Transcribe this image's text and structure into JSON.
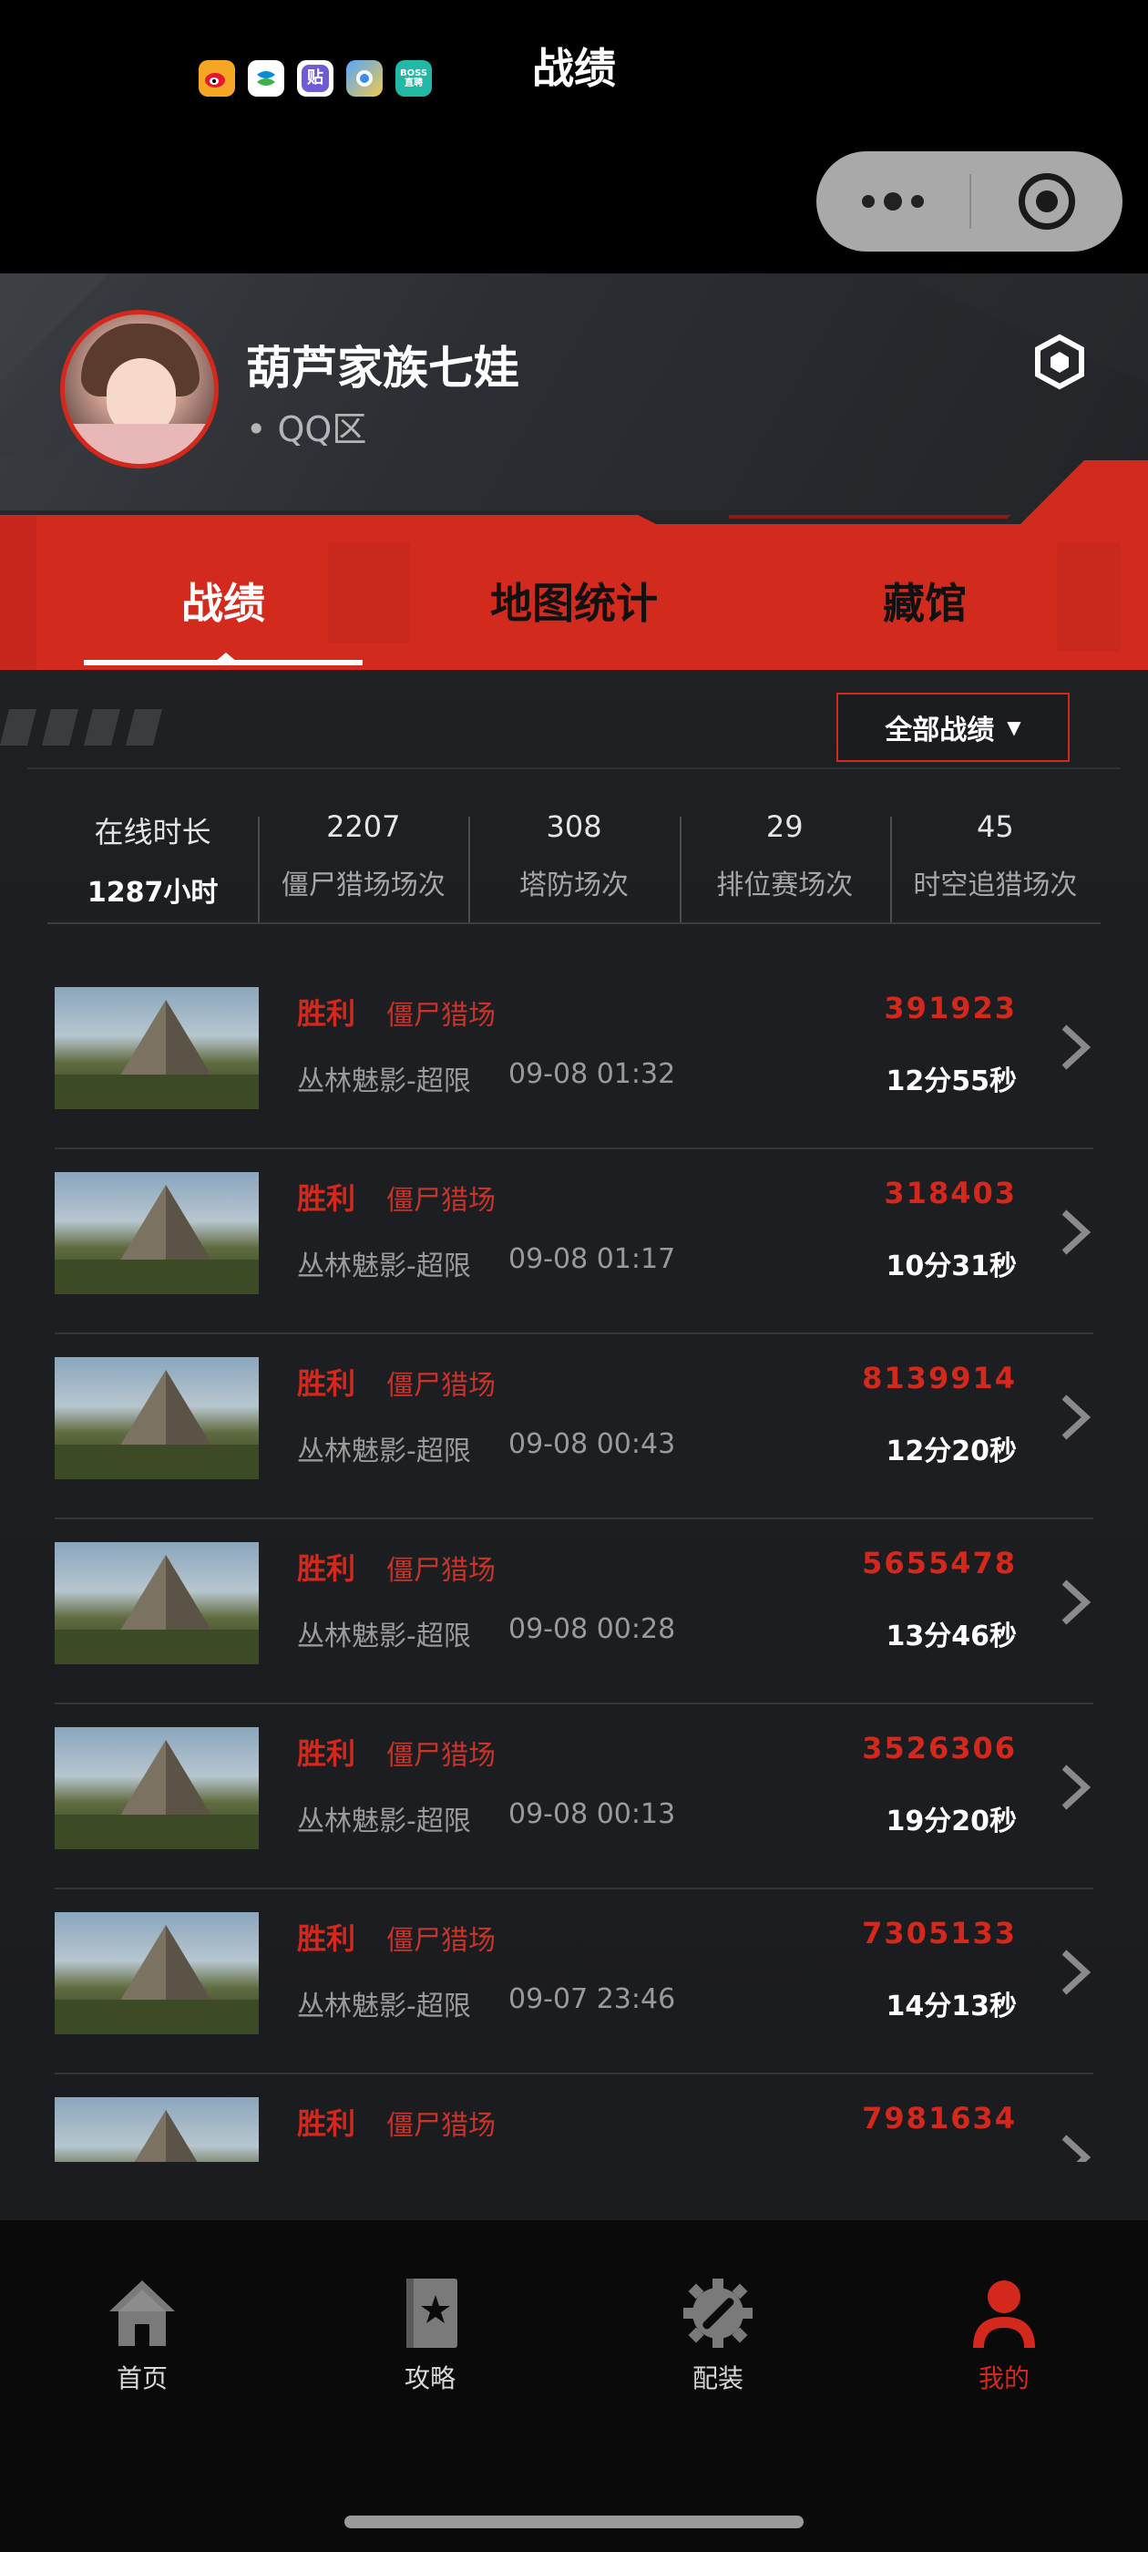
{
  "status_bar": {
    "notification_icons": [
      {
        "name": "weibo-icon",
        "color": "#f5a623",
        "text": ""
      },
      {
        "name": "china-mobile-icon",
        "color": "#ffffff",
        "text": ""
      },
      {
        "name": "tieba-icon",
        "color": "#6e5bd6",
        "text": "贴"
      },
      {
        "name": "browser-icon",
        "color": "#3b8ef0",
        "text": ""
      },
      {
        "name": "boss-zhipin-icon",
        "color": "#21b8a5",
        "text": "BOSS\n直聘"
      }
    ]
  },
  "nav": {
    "title": "战绩"
  },
  "profile": {
    "username": "葫芦家族七娃",
    "server": "• QQ区"
  },
  "tabs": [
    {
      "label": "战绩",
      "active": true
    },
    {
      "label": "地图统计",
      "active": false
    },
    {
      "label": "藏馆",
      "active": false
    }
  ],
  "filter": {
    "label": "全部战绩",
    "arrow": "▼"
  },
  "stats": [
    {
      "top": "在线时长",
      "bottom": "1287小时"
    },
    {
      "top": "2207",
      "bottom": "僵尸猎场场次"
    },
    {
      "top": "308",
      "bottom": "塔防场次"
    },
    {
      "top": "29",
      "bottom": "排位赛场次"
    },
    {
      "top": "45",
      "bottom": "时空追猎场次"
    }
  ],
  "matches": [
    {
      "result": "胜利",
      "mode": "僵尸猎场",
      "map": "丛林魅影-超限",
      "time": "09-08 01:32",
      "score": "391923",
      "duration": "12分55秒"
    },
    {
      "result": "胜利",
      "mode": "僵尸猎场",
      "map": "丛林魅影-超限",
      "time": "09-08 01:17",
      "score": "318403",
      "duration": "10分31秒"
    },
    {
      "result": "胜利",
      "mode": "僵尸猎场",
      "map": "丛林魅影-超限",
      "time": "09-08 00:43",
      "score": "8139914",
      "duration": "12分20秒"
    },
    {
      "result": "胜利",
      "mode": "僵尸猎场",
      "map": "丛林魅影-超限",
      "time": "09-08 00:28",
      "score": "5655478",
      "duration": "13分46秒"
    },
    {
      "result": "胜利",
      "mode": "僵尸猎场",
      "map": "丛林魅影-超限",
      "time": "09-08 00:13",
      "score": "3526306",
      "duration": "19分20秒"
    },
    {
      "result": "胜利",
      "mode": "僵尸猎场",
      "map": "丛林魅影-超限",
      "time": "09-07 23:46",
      "score": "7305133",
      "duration": "14分13秒"
    },
    {
      "result": "胜利",
      "mode": "僵尸猎场",
      "map": "",
      "time": "",
      "score": "7981634",
      "duration": ""
    }
  ],
  "bottom_tabs": [
    {
      "label": "首页",
      "icon": "home-icon",
      "active": false
    },
    {
      "label": "攻略",
      "icon": "guide-book-icon",
      "active": false
    },
    {
      "label": "配装",
      "icon": "gear-wrench-icon",
      "active": false
    },
    {
      "label": "我的",
      "icon": "profile-icon",
      "active": true
    }
  ],
  "colors": {
    "accent_red": "#d5281d",
    "background": "#1b1c1f",
    "tab_bar": "#0a0a0a"
  }
}
